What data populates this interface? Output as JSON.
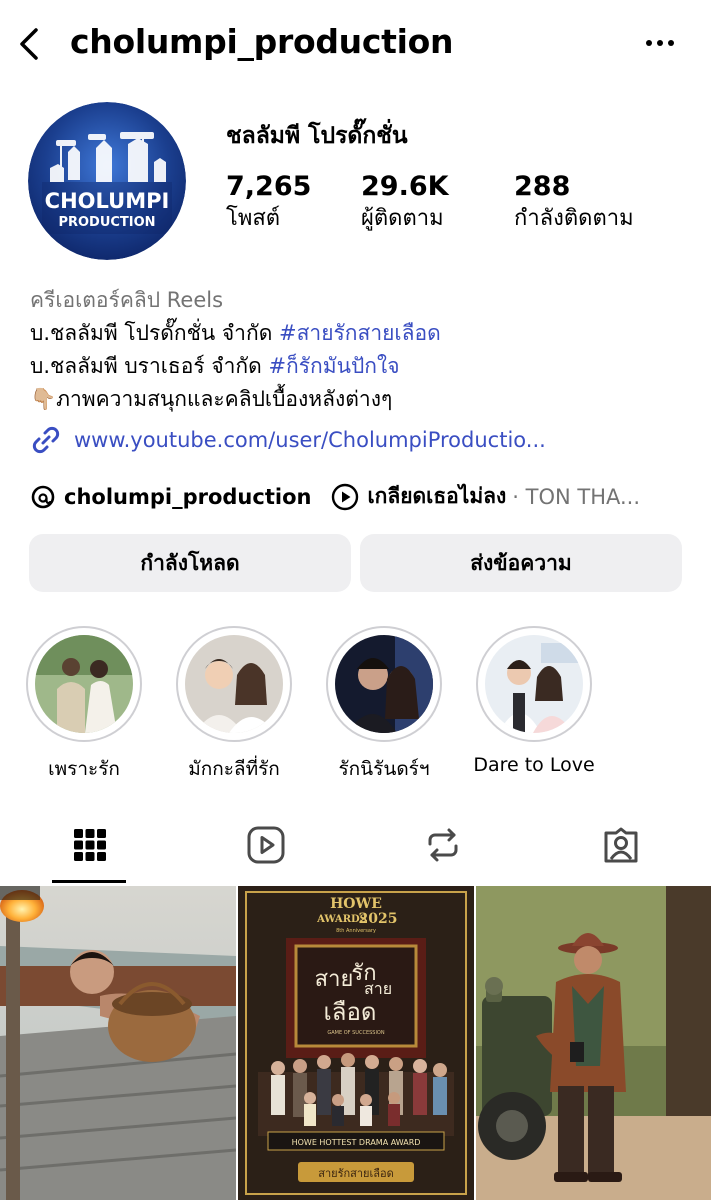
{
  "header": {
    "username": "cholumpi_production",
    "back_icon": "chevron-left-icon",
    "more_icon": "more-horizontal-icon"
  },
  "profile": {
    "display_name": "ชลลัมพี โปรดั๊กชั่น",
    "avatar_text_top": "CHOLUMPI",
    "avatar_text_bottom": "PRODUCTION",
    "stats": {
      "posts_count": "7,265",
      "posts_label": "โพสต์",
      "followers_count": "29.6K",
      "followers_label": "ผู้ติดตาม",
      "following_count": "288",
      "following_label": "กำลังติดตาม"
    }
  },
  "bio": {
    "category": "ครีเอเตอร์คลิป Reels",
    "line1_text": "บ.ชลลัมพี โปรดั๊กชั่น จำกัด ",
    "line1_tag": "#สายรักสายเลือด",
    "line2_text": "บ.ชลลัมพี บราเธอร์ จำกัด ",
    "line2_tag": "#ก็รักมันปักใจ",
    "line3_emoji": "👇🏼",
    "line3_text": "ภาพความสนุกและคลิปเบื้องหลังต่างๆ",
    "link": "www.youtube.com/user/CholumpiProductio..."
  },
  "threads": {
    "name": "cholumpi_production",
    "song": "เกลียดเธอไม่ลง",
    "artist": "· TON THA..."
  },
  "buttons": {
    "follow": "กำลังโหลด",
    "message": "ส่งข้อความ"
  },
  "highlights": [
    {
      "label": "เพราะรัก"
    },
    {
      "label": "มักกะลีที่รัก"
    },
    {
      "label": "รักนิรันดร์ฯ"
    },
    {
      "label": "Dare to Love"
    }
  ],
  "tabs": [
    {
      "name": "posts",
      "icon": "grid-icon",
      "active": true
    },
    {
      "name": "reels",
      "icon": "reels-icon",
      "active": false
    },
    {
      "name": "reposts",
      "icon": "repost-icon",
      "active": false
    },
    {
      "name": "tagged",
      "icon": "tagged-icon",
      "active": false
    }
  ],
  "posts": [
    {
      "kind": "photo"
    },
    {
      "award_brand": "HOWE",
      "award_sub": "AWARDS",
      "award_year": "2025",
      "award_anniv": "8th Anniversary",
      "poster_title_1": "สาย",
      "poster_title_2": "รัก",
      "poster_title_3": "สาย",
      "poster_title_4": "เลือด",
      "poster_en": "GAME OF SUCCESSION",
      "award_banner": "HOWE HOTTEST DRAMA AWARD",
      "drama_name": "สายรักสายเลือด"
    },
    {
      "kind": "photo"
    }
  ],
  "colors": {
    "link": "#3a4ec2",
    "muted": "#737373",
    "button_bg": "#efeff1",
    "avatar_blue": "#1b3f8f"
  }
}
